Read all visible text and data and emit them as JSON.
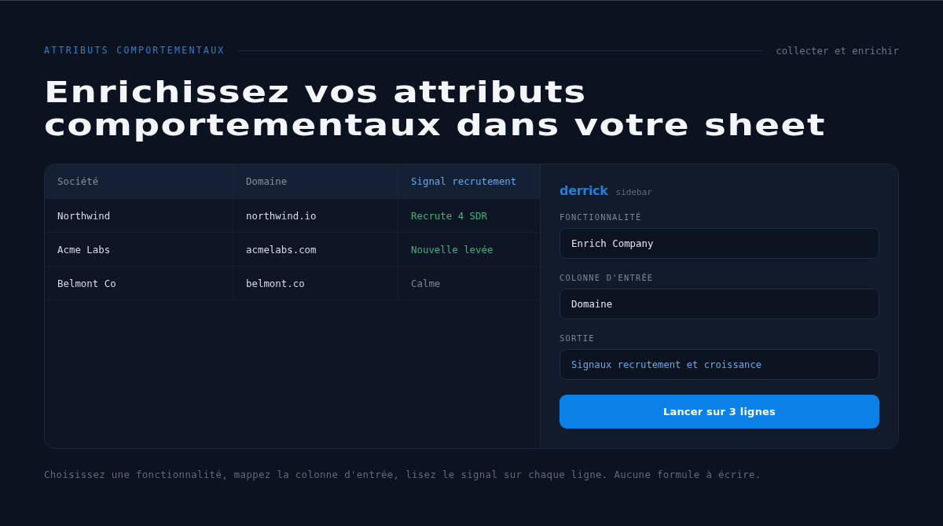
{
  "header": {
    "eyebrow": "ATTRIBUTS COMPORTEMENTAUX",
    "tagline": "collecter et enrichir"
  },
  "title": "Enrichissez vos attributs comportementaux dans votre sheet",
  "table": {
    "columns": [
      {
        "label": "Société",
        "highlighted": false
      },
      {
        "label": "Domaine",
        "highlighted": false
      },
      {
        "label": "Signal recrutement",
        "highlighted": true
      }
    ],
    "rows": [
      {
        "company": "Northwind",
        "domain": "northwind.io",
        "signal": "Recrute 4 SDR",
        "color": "#4aac7a"
      },
      {
        "company": "Acme Labs",
        "domain": "acmelabs.com",
        "signal": "Nouvelle levée",
        "color": "#4aac7a"
      },
      {
        "company": "Belmont Co",
        "domain": "belmont.co",
        "signal": "Calme",
        "color": "#7b8696"
      }
    ]
  },
  "sidebar": {
    "brand": "derrick",
    "subtitle": "sidebar",
    "fields": [
      {
        "label": "FONCTIONNALITÉ",
        "value": "Enrich Company",
        "kind": "input"
      },
      {
        "label": "COLONNE D'ENTRÉE",
        "value": "Domaine",
        "kind": "input"
      },
      {
        "label": "SORTIE",
        "value": "Signaux recrutement et croissance",
        "kind": "output"
      }
    ],
    "button": "Lancer sur 3 lignes"
  },
  "footer": "Choisissez une fonctionnalité, mappez la colonne d'entrée, lisez le signal sur chaque ligne. Aucune formule à écrire."
}
